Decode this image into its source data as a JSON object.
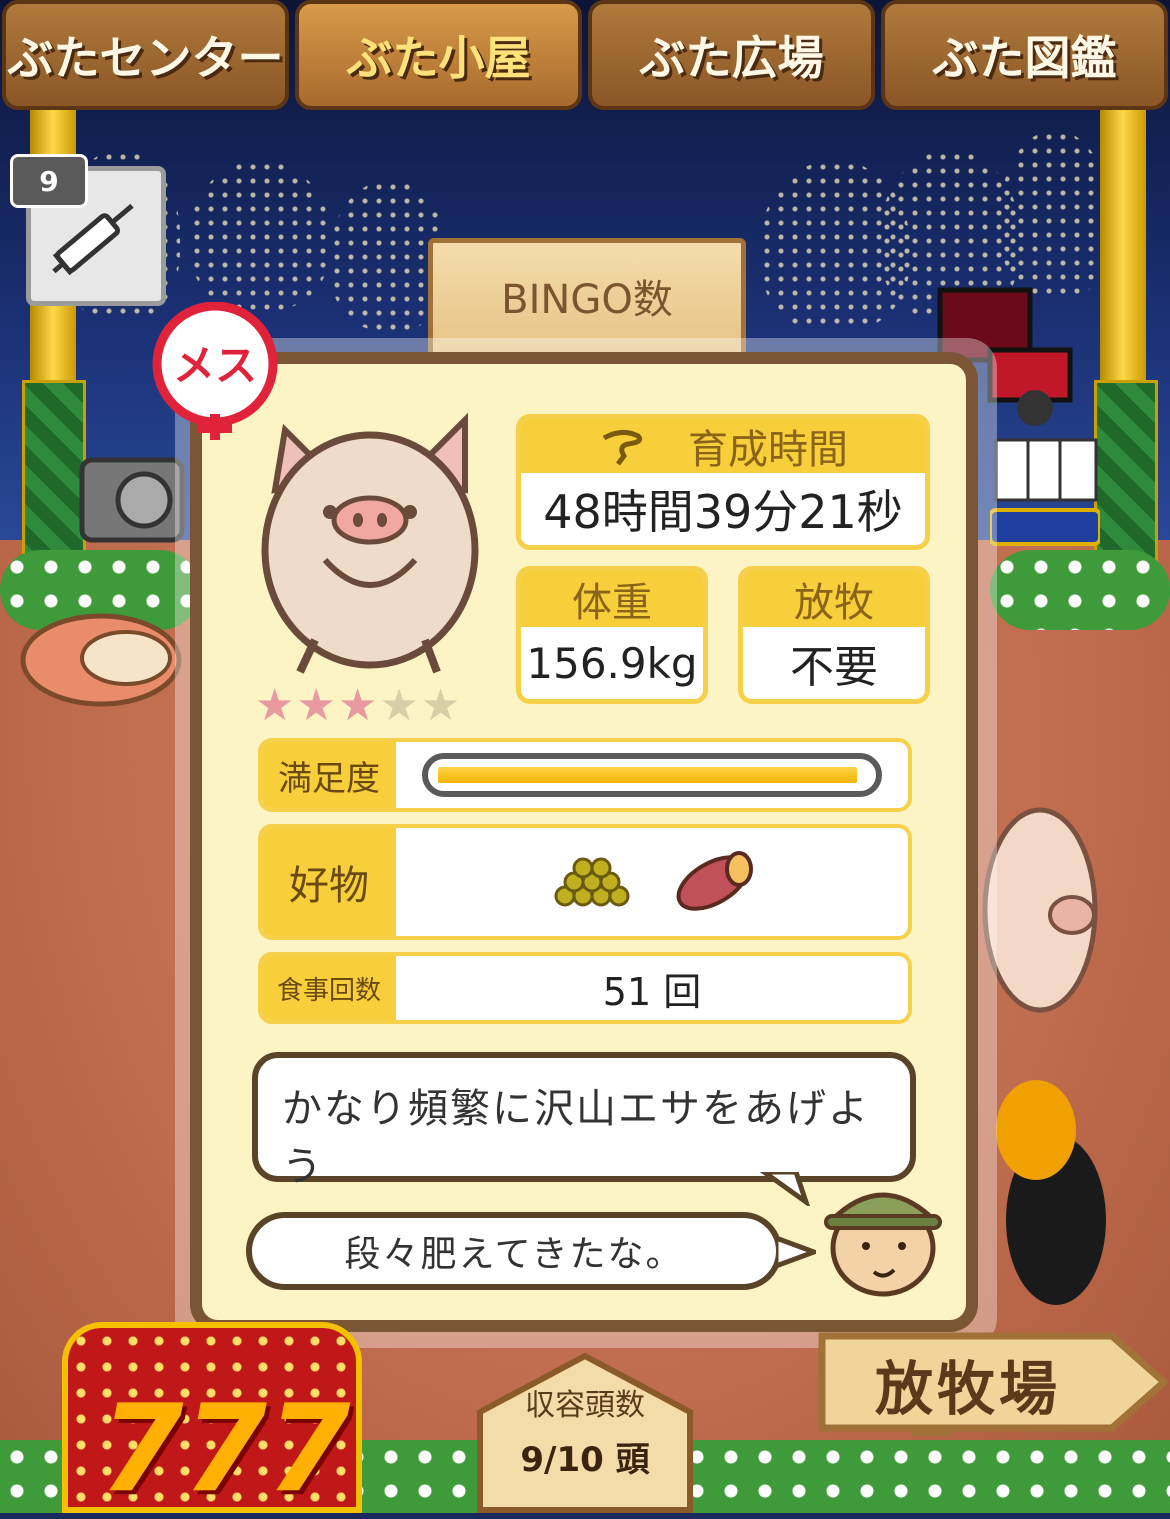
{
  "tabs": [
    {
      "label": "ぶたセンター",
      "active": false
    },
    {
      "label": "ぶた小屋",
      "active": true
    },
    {
      "label": "ぶた広場",
      "active": false
    },
    {
      "label": "ぶた図鑑",
      "active": false
    }
  ],
  "item": {
    "count": "9",
    "icon": "syringe-icon"
  },
  "bingo_sign": {
    "title": "BINGO数"
  },
  "pig": {
    "gender": "メス",
    "rating": 3,
    "rating_max": 5,
    "growth_time_label": "育成時間",
    "growth_time": "48時間39分21秒",
    "weight_label": "体重",
    "weight": "156.9kg",
    "grazing_label": "放牧",
    "grazing": "不要",
    "satisfaction_label": "満足度",
    "satisfaction_level": 0.98,
    "favorite_label": "好物",
    "favorite_icons": [
      "feed-pellets-icon",
      "sweet-potato-icon"
    ],
    "meals_label": "食事回数",
    "meals": "51 回"
  },
  "advice": "かなり頻繁に沢山エサをあげよう",
  "comment": "段々肥えてきたな。",
  "capacity": {
    "title": "収容頭数",
    "value": "9/10 頭"
  },
  "grazing_sign": "放牧場",
  "slot": {
    "number": "777"
  },
  "colors": {
    "panel_bg": "#fcf4c4",
    "panel_border": "#7a5634",
    "accent_yellow": "#f7cf3a",
    "gender_red": "#e0223a"
  }
}
